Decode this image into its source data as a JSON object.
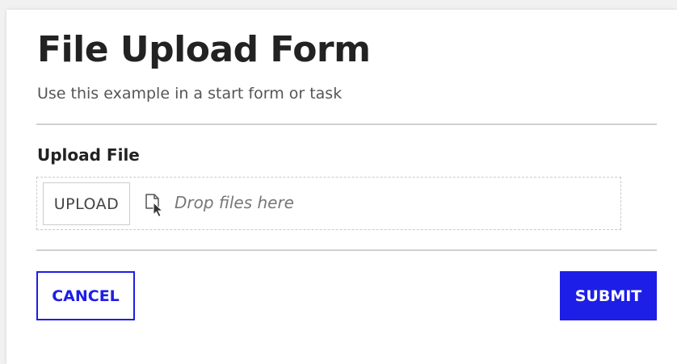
{
  "form": {
    "title": "File Upload Form",
    "subtitle": "Use this example in a start form or task"
  },
  "upload_field": {
    "label": "Upload File",
    "button_label": "UPLOAD",
    "drop_text": "Drop files here",
    "icon": "file-drop-icon"
  },
  "actions": {
    "cancel_label": "CANCEL",
    "submit_label": "SUBMIT"
  },
  "colors": {
    "accent": "#1d1ee6",
    "text": "#222222",
    "muted": "#777777",
    "divider": "#d0d0d0"
  }
}
